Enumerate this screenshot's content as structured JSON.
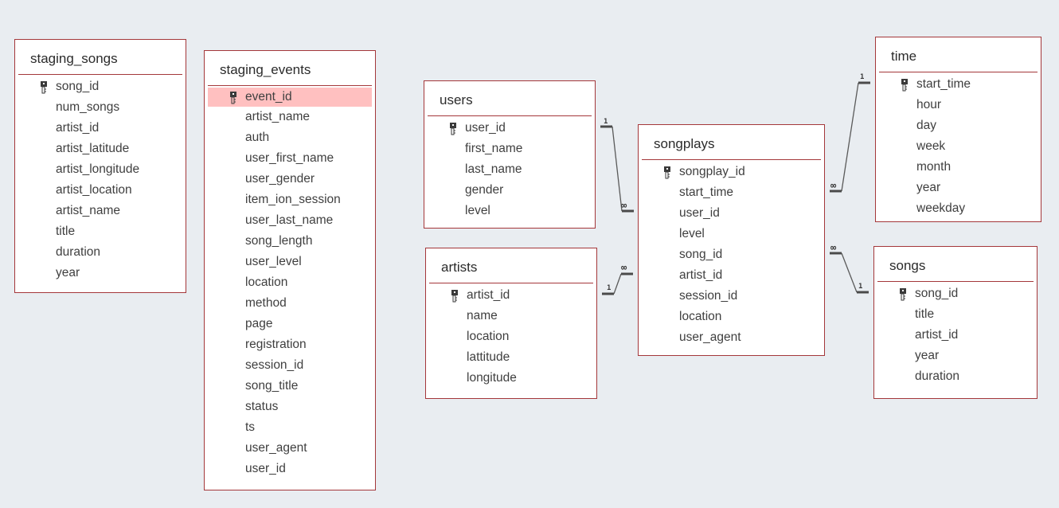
{
  "colors": {
    "canvas_background": "#e9edf1",
    "table_border": "#a4373a",
    "selected_row": "#ffc0c0",
    "connector": "#555555"
  },
  "tables": {
    "staging_songs": {
      "name": "staging_songs",
      "fields": [
        "song_id",
        "num_songs",
        "artist_id",
        "artist_latitude",
        "artist_longitude",
        "artist_location",
        "artist_name",
        "title",
        "duration",
        "year"
      ],
      "primary_key": "song_id"
    },
    "staging_events": {
      "name": "staging_events",
      "fields": [
        "event_id",
        "artist_name",
        "auth",
        "user_first_name",
        "user_gender",
        "item_ion_session",
        "user_last_name",
        "song_length",
        "user_level",
        "location",
        "method",
        "page",
        "registration",
        "session_id",
        "song_title",
        "status",
        "ts",
        "user_agent",
        "user_id"
      ],
      "primary_key": "event_id",
      "selected_field": "event_id"
    },
    "users": {
      "name": "users",
      "fields": [
        "user_id",
        "first_name",
        "last_name",
        "gender",
        "level"
      ],
      "primary_key": "user_id"
    },
    "artists": {
      "name": "artists",
      "fields": [
        "artist_id",
        "name",
        "location",
        "lattitude",
        "longitude"
      ],
      "primary_key": "artist_id"
    },
    "songplays": {
      "name": "songplays",
      "fields": [
        "songplay_id",
        "start_time",
        "user_id",
        "level",
        "song_id",
        "artist_id",
        "session_id",
        "location",
        "user_agent"
      ],
      "primary_key": "songplay_id"
    },
    "time": {
      "name": "time",
      "fields": [
        "start_time",
        "hour",
        "day",
        "week",
        "month",
        "year",
        "weekday"
      ],
      "primary_key": "start_time"
    },
    "songs": {
      "name": "songs",
      "fields": [
        "song_id",
        "title",
        "artist_id",
        "year",
        "duration"
      ],
      "primary_key": "song_id"
    }
  },
  "relationships": [
    {
      "from": "users",
      "to": "songplays",
      "from_card": "1",
      "to_card": "∞"
    },
    {
      "from": "artists",
      "to": "songplays",
      "from_card": "1",
      "to_card": "∞"
    },
    {
      "from": "time",
      "to": "songplays",
      "from_card": "1",
      "to_card": "∞"
    },
    {
      "from": "songs",
      "to": "songplays",
      "from_card": "1",
      "to_card": "∞"
    }
  ]
}
